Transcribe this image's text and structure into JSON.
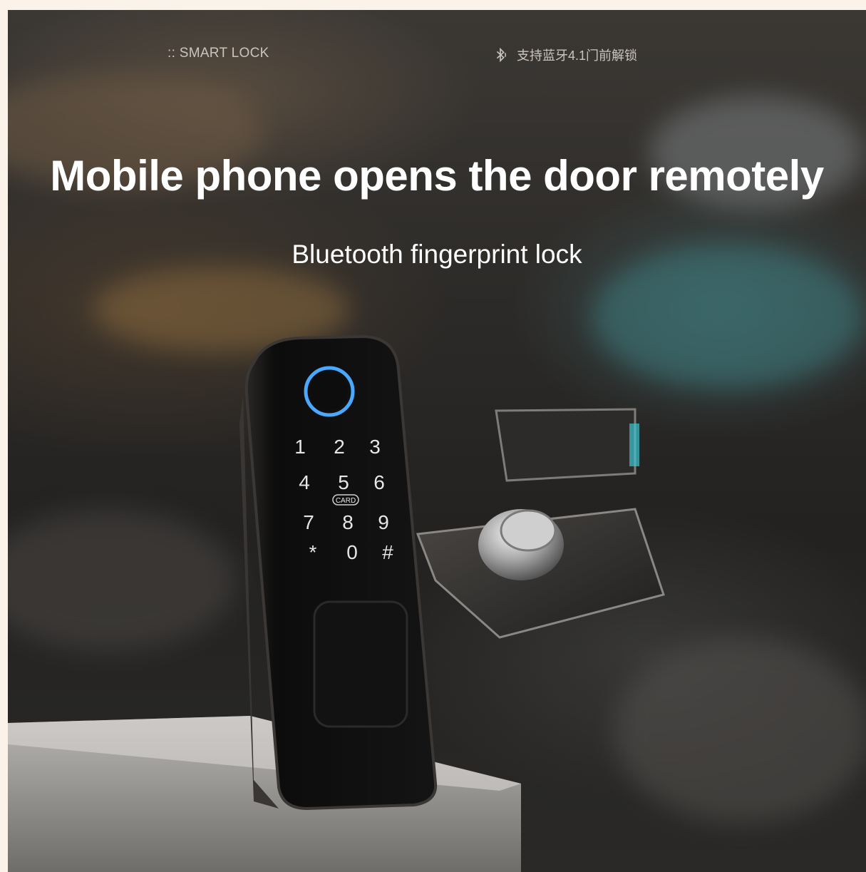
{
  "header": {
    "brand": ":: SMART LOCK",
    "bluetooth_text": "支持蓝牙4.1门前解锁"
  },
  "headline": "Mobile phone opens the door remotely",
  "subheadline": "Bluetooth fingerprint lock",
  "keypad": {
    "keys": [
      "1",
      "2",
      "3",
      "4",
      "5",
      "6",
      "7",
      "8",
      "9",
      "*",
      "0",
      "#"
    ],
    "card_label": "CARD"
  },
  "colors": {
    "page_bg": "#fbf3ea",
    "fingerprint_ring": "#4aa8ff",
    "text": "#ffffff"
  }
}
